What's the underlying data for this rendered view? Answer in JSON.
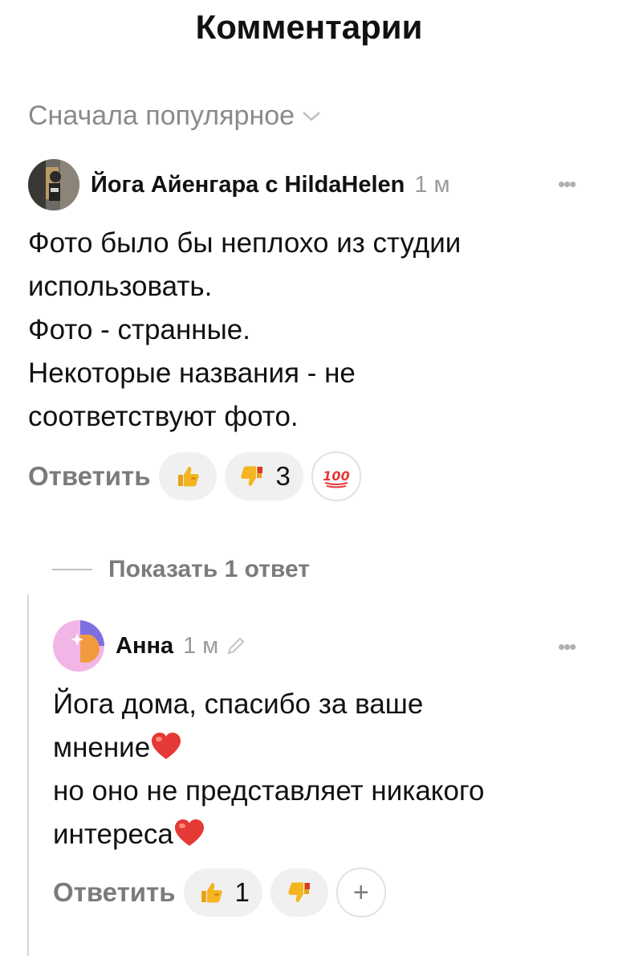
{
  "header": {
    "title": "Комментарии"
  },
  "sort": {
    "label": "Сначала популярное"
  },
  "comments": [
    {
      "author": "Йога Айенгара с HildaHelen",
      "time": "1 м",
      "lines": [
        "Фото было бы неплохо из студии",
        "использовать.",
        "Фото - странные.",
        "Некоторые названия - не",
        "соответствуют фото."
      ],
      "reply_label": "Ответить",
      "reactions": [
        {
          "icon": "thumbs-up-icon",
          "count": ""
        },
        {
          "icon": "thumbs-down-icon",
          "count": "3"
        },
        {
          "icon": "hundred-points-icon",
          "count": ""
        }
      ]
    }
  ],
  "show_replies": {
    "label": "Показать 1 ответ"
  },
  "reply": {
    "author": "Анна",
    "time": "1 м",
    "lines": [
      "Йога дома, спасибо за ваше",
      "мнение",
      "но оно не представляет никакого",
      "интереса"
    ],
    "reply_label": "Ответить",
    "reactions": [
      {
        "icon": "thumbs-up-icon",
        "count": "1"
      },
      {
        "icon": "thumbs-down-icon",
        "count": ""
      }
    ],
    "add_reaction": "+"
  },
  "colors": {
    "muted": "#7b7b7b",
    "pill": "#f0f0f0",
    "heart": "#e53935",
    "thumb": "#f5b422"
  }
}
